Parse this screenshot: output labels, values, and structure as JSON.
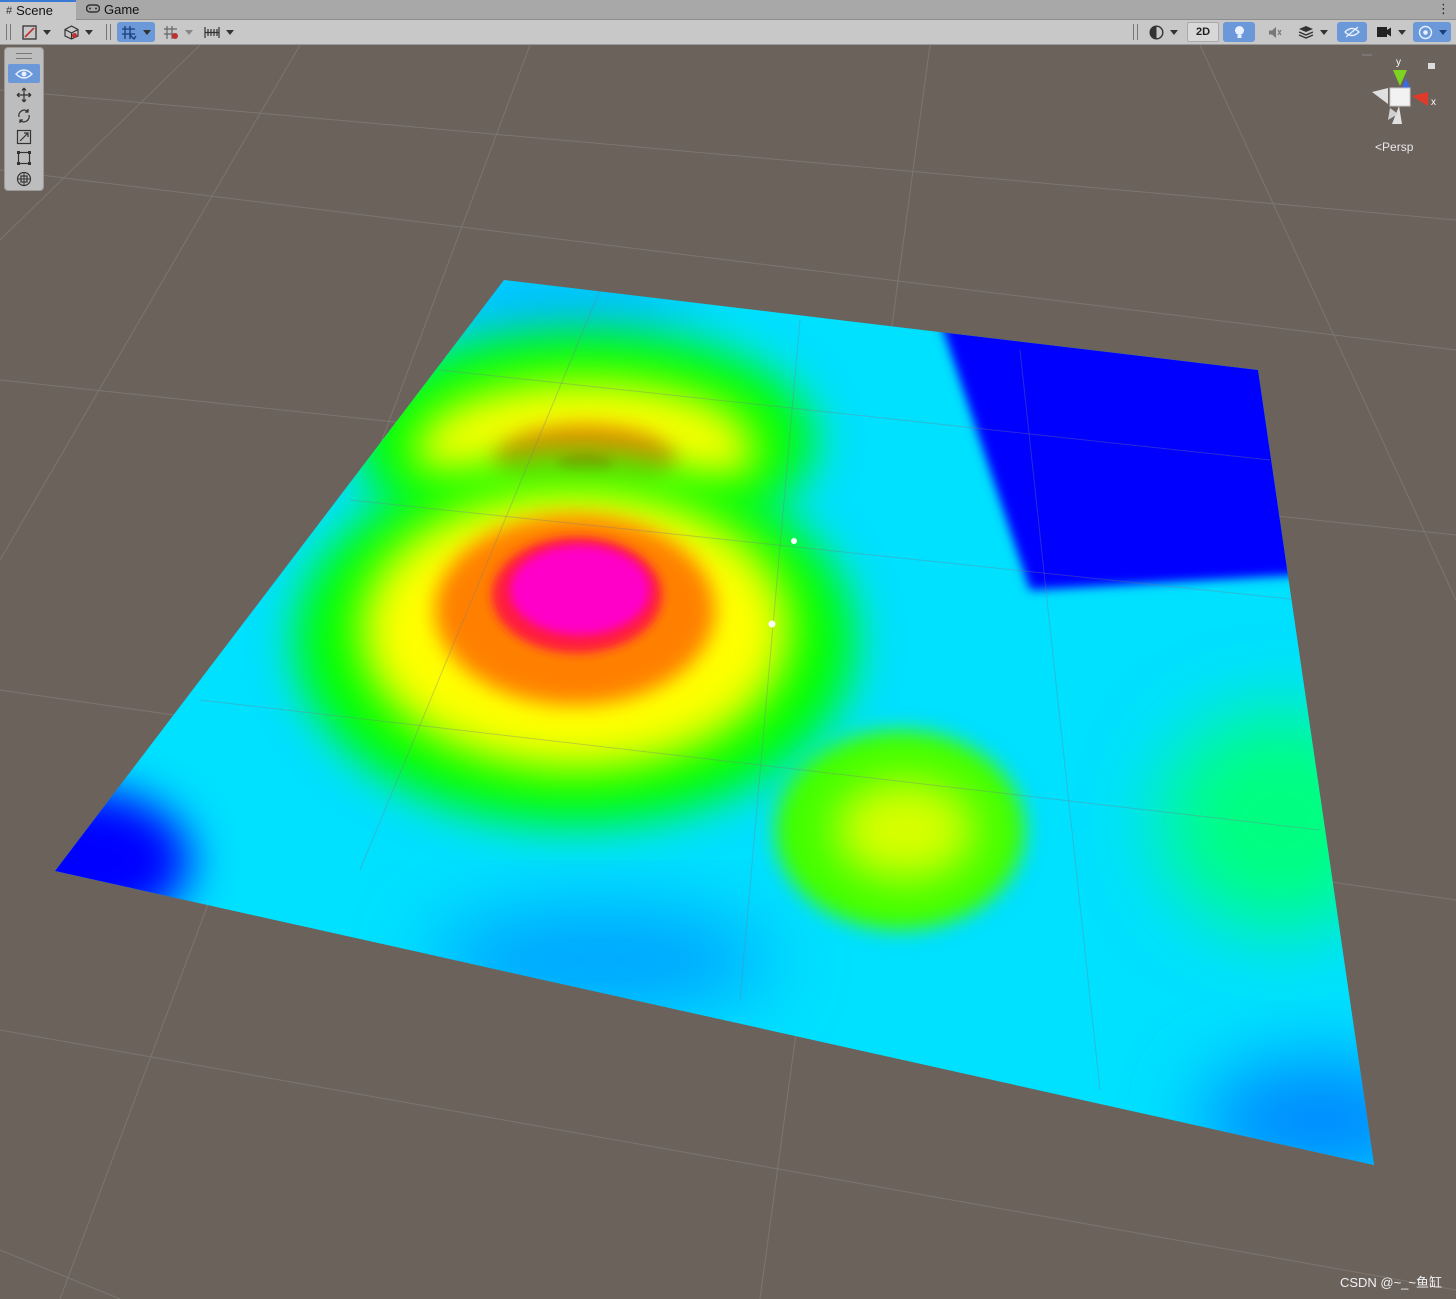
{
  "tabs": [
    {
      "label": "Scene",
      "icon": "grid-icon",
      "active": true
    },
    {
      "label": "Game",
      "icon": "gamepad-icon",
      "active": false
    }
  ],
  "tab_menu": "⋮",
  "toolbar": {
    "left": [
      "draw-mode-icon",
      "shading-cube-icon",
      "grid-snap-icon",
      "increment-snap-icon",
      "ruler-icon"
    ],
    "right": [
      "render-sphere-icon",
      "lighting-icon",
      "audio-mute-icon",
      "effects-icon",
      "hidden-objects-icon",
      "camera-icon",
      "gizmos-icon"
    ],
    "label_2d": "2D"
  },
  "tools": [
    "view-tool-icon",
    "move-tool-icon",
    "rotate-tool-icon",
    "scale-tool-icon",
    "rect-tool-icon",
    "transform-tool-icon"
  ],
  "gizmo": {
    "axis_y": "y",
    "axis_x": "x",
    "projection": "Persp"
  },
  "colors": {
    "background": "#6b625c",
    "selection_blue": "#6a98d8",
    "heatmap": [
      "#0000ff",
      "#00ffff",
      "#00ff00",
      "#ffff00",
      "#ff8000",
      "#ff0000",
      "#ff00ff"
    ]
  },
  "watermark": "CSDN @~_~鱼缸"
}
